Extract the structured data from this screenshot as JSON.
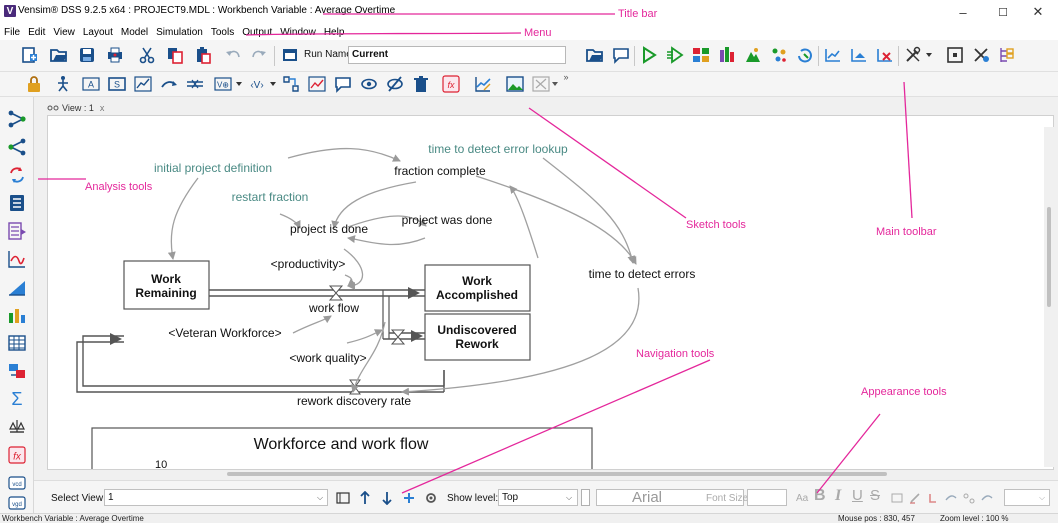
{
  "window": {
    "title": "Vensim® DSS 9.2.5 x64 : PROJECT9.MDL : Workbench Variable : Average Overtime",
    "logo_letter": "V",
    "minimize_glyph": "–",
    "maximize_glyph": "☐",
    "close_glyph": "✕"
  },
  "menu": {
    "items": [
      "File",
      "Edit",
      "View",
      "Layout",
      "Model",
      "Simulation",
      "Tools",
      "Output",
      "Window",
      "Help"
    ]
  },
  "toolbar": {
    "run_name_label": "Run Name:",
    "run_name_value": "Current",
    "overflow_glyph": "»"
  },
  "view": {
    "tab_label": "View : 1",
    "tab_close": "x"
  },
  "model": {
    "stocks": {
      "work_remaining": [
        "Work",
        "Remaining"
      ],
      "work_accomplished": [
        "Work",
        "Accomplished"
      ],
      "undiscovered_rework": [
        "Undiscovered",
        "Rework"
      ]
    },
    "variables": {
      "initial_project_definition": "initial project definition",
      "fraction_complete": "fraction complete",
      "time_to_detect_error_lookup": "time to detect error lookup",
      "restart_fraction": "restart fraction",
      "project_is_done": "project is done",
      "project_was_done": "project was done",
      "productivity": "<productivity>",
      "work_flow": "work flow",
      "veteran_workforce": "<Veteran Workforce>",
      "work_quality": "<work quality>",
      "time_to_detect_errors": "time to detect errors",
      "rework_discovery_rate": "rework discovery rate"
    },
    "graph": {
      "title": "Workforce and work flow",
      "y_tick": "10"
    }
  },
  "bottom": {
    "select_view_label": "Select View :",
    "select_view_value": "1",
    "show_level_label": "Show level:",
    "show_level_value": "Top",
    "font_name": "Arial",
    "font_size_label": "Font Size :",
    "aa_label": "Aa"
  },
  "status": {
    "left": "Workbench Variable : Average Overtime",
    "mouse_pos": "Mouse pos : 830, 457",
    "zoom": "Zoom level : 100 %"
  },
  "annotations": {
    "title_bar": "Title bar",
    "menu": "Menu",
    "analysis_tools": "Analysis tools",
    "sketch_tools": "Sketch tools",
    "main_toolbar": "Main toolbar",
    "navigation_tools": "Navigation tools",
    "appearance_tools": "Appearance tools"
  },
  "colors": {
    "annotation": "#e4279b",
    "teal_variable": "#4a8a84",
    "arrow_gray": "#a0a0a0",
    "run_green": "#1a9a2a"
  }
}
